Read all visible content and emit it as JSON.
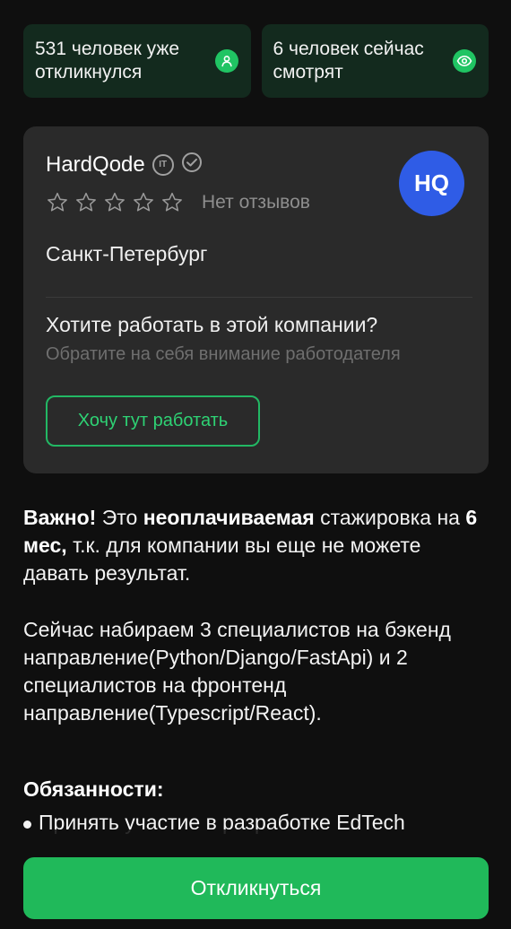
{
  "stats": [
    {
      "text": "531 человек уже\nоткликнулся",
      "icon": "person-icon"
    },
    {
      "text": "6 человек сейчас\nсмотрят",
      "icon": "eye-icon"
    }
  ],
  "company": {
    "name": "HardQode",
    "it_badge": "IT",
    "rating_stars": 0,
    "reviews_label": "Нет отзывов",
    "logo_text": "HQ",
    "logo_color": "#2f5ce6",
    "city": "Санкт-Петербург",
    "cta_title": "Хотите работать в этой компании?",
    "cta_subtitle": "Обратите на себя внимание работодателя",
    "cta_button": "Хочу тут работать"
  },
  "description": {
    "p1_part1": "Важно!",
    "p1_part2": " Это ",
    "p1_part3": "неоплачиваемая",
    "p1_part4": " стажировка на ",
    "p1_part5": "6 мес,",
    "p1_part6": " т.к. для компании вы еще не можете давать результат.",
    "p2": "Сейчас набираем 3 специалистов на бэкенд направление(Python/Django/FastApi) и 2 специалистов на фронтенд направление(Typescript/React).",
    "duties_title": "Обязанности:",
    "duty_1": "Принять участие в разработке EdTech"
  },
  "respond_button": "Откликнуться",
  "colors": {
    "accent": "#20b95a",
    "background": "#0f0f0f",
    "card": "#2a2a2a",
    "stat_tile": "#132a1e"
  }
}
